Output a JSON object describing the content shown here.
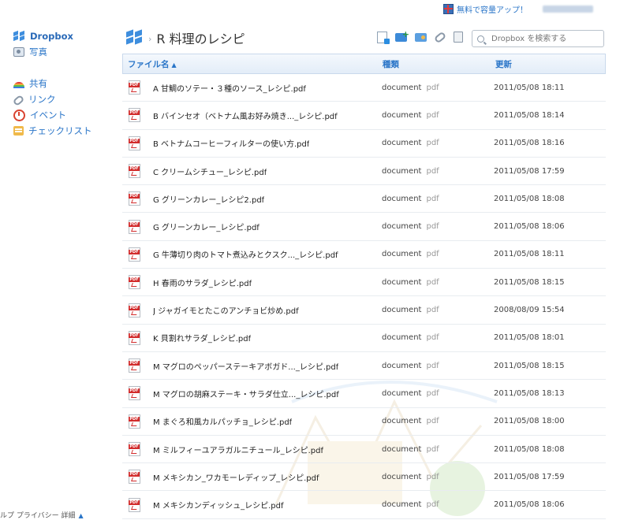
{
  "topbar": {
    "upgrade_label": "無料で容量アップ！"
  },
  "sidebar": {
    "items": [
      {
        "label": "Dropbox",
        "icon": "dropbox-box-icon"
      },
      {
        "label": "写真",
        "icon": "photo-icon"
      },
      {
        "label": "共有",
        "icon": "share-icon"
      },
      {
        "label": "リンク",
        "icon": "link-icon"
      },
      {
        "label": "イベント",
        "icon": "event-icon"
      },
      {
        "label": "チェックリスト",
        "icon": "checklist-icon"
      }
    ]
  },
  "footer": {
    "text": "ルプ プライバシー 詳細",
    "caret": "▲"
  },
  "header": {
    "breadcrumb_separator": "›",
    "folder_title": "R 料理のレシピ"
  },
  "search": {
    "placeholder": "Dropbox を検索する"
  },
  "table": {
    "columns": {
      "name": "ファイル名",
      "name_sort": "▲",
      "kind": "種類",
      "modified": "更新"
    },
    "rows": [
      {
        "name": "A 甘鯛のソテー・３種のソース_レシピ.pdf",
        "kind": "document",
        "ext": "pdf",
        "modified": "2011/05/08 18:11"
      },
      {
        "name": "B バインセオ（ベトナム風お好み焼き..._レシピ.pdf",
        "kind": "document",
        "ext": "pdf",
        "modified": "2011/05/08 18:14"
      },
      {
        "name": "B ベトナムコーヒーフィルターの使い方.pdf",
        "kind": "document",
        "ext": "pdf",
        "modified": "2011/05/08 18:16"
      },
      {
        "name": "C クリームシチュー_レシピ.pdf",
        "kind": "document",
        "ext": "pdf",
        "modified": "2011/05/08 17:59"
      },
      {
        "name": "G グリーンカレー_レシピ2.pdf",
        "kind": "document",
        "ext": "pdf",
        "modified": "2011/05/08 18:08"
      },
      {
        "name": "G グリーンカレー_レシピ.pdf",
        "kind": "document",
        "ext": "pdf",
        "modified": "2011/05/08 18:06"
      },
      {
        "name": "G 牛薄切り肉のトマト煮込みとクスク..._レシピ.pdf",
        "kind": "document",
        "ext": "pdf",
        "modified": "2011/05/08 18:11"
      },
      {
        "name": "H 春雨のサラダ_レシピ.pdf",
        "kind": "document",
        "ext": "pdf",
        "modified": "2011/05/08 18:15"
      },
      {
        "name": "J ジャガイモとたこのアンチョビ炒め.pdf",
        "kind": "document",
        "ext": "pdf",
        "modified": "2008/08/09 15:54"
      },
      {
        "name": "K 貝割れサラダ_レシピ.pdf",
        "kind": "document",
        "ext": "pdf",
        "modified": "2011/05/08 18:01"
      },
      {
        "name": "M マグロのペッパーステーキアボガド..._レシピ.pdf",
        "kind": "document",
        "ext": "pdf",
        "modified": "2011/05/08 18:15"
      },
      {
        "name": "M マグロの胡麻ステーキ・サラダ仕立..._レシピ.pdf",
        "kind": "document",
        "ext": "pdf",
        "modified": "2011/05/08 18:13"
      },
      {
        "name": "M まぐろ和風カルパッチョ_レシピ.pdf",
        "kind": "document",
        "ext": "pdf",
        "modified": "2011/05/08 18:00"
      },
      {
        "name": "M ミルフィーユアラガルニチュール_レシピ.pdf",
        "kind": "document",
        "ext": "pdf",
        "modified": "2011/05/08 18:08"
      },
      {
        "name": "M メキシカン_ワカモーレディップ_レシピ.pdf",
        "kind": "document",
        "ext": "pdf",
        "modified": "2011/05/08 17:59"
      },
      {
        "name": "M メキシカンディッシュ_レシピ.pdf",
        "kind": "document",
        "ext": "pdf",
        "modified": "2011/05/08 18:06"
      }
    ]
  },
  "colors": {
    "accent": "#2a75c8",
    "header_bg": "#e3edf8"
  }
}
